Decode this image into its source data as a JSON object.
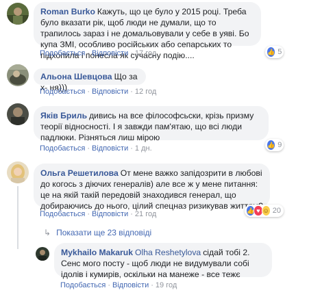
{
  "actions": {
    "like": "Подобається",
    "reply": "Відповісти",
    "sep": "·"
  },
  "comments": [
    {
      "author": "Roman Burko",
      "text": "Кажуть, що це було у 2015 році. Треба було вказати рік, щоб люди не думали, що то трапилось зараз і не домальовували у себе в уяві. Бо купа ЗМІ, особливо російських або сепарських то підхопила і понесла як сучасну подію....",
      "time": "17 год",
      "reaction_count": "5"
    },
    {
      "author": "Альона Шевцова",
      "text": "Що за х- ня)))",
      "time": "12 год"
    },
    {
      "author": "Яків Бриль",
      "text": "дивись на все філософсьски, крізь призму теорії відносності. І я завжди пам'ятаю, що всі люди падлюки. Різняться лиш мірою",
      "time": "1 дн.",
      "reaction_count": "9"
    },
    {
      "author": "Ольга Решетилова",
      "text": "От мене важко запідозрити в любові до когось з діючих генералів) але все ж у мене питання: це на якій такій передовій знаходився генерал, що добираючись до нього, цілий спецназ ризикував життям?",
      "time": "21 год",
      "reaction_count": "20"
    }
  ],
  "more_replies": "Показати ще 23 відповіді",
  "reply": {
    "author": "Mykhailo Makaruk",
    "tag": "Olha Reshetylova",
    "text": "сідай тобі 2. Сенс мого посту - щоб люди не видумували собі ідолів і кумирів, оскільки на манеже - все тежє",
    "time": "19 год"
  },
  "colors": {
    "link": "#385898",
    "bubble": "#f2f3f5",
    "meta": "#90949c",
    "action": "#4267b2"
  }
}
